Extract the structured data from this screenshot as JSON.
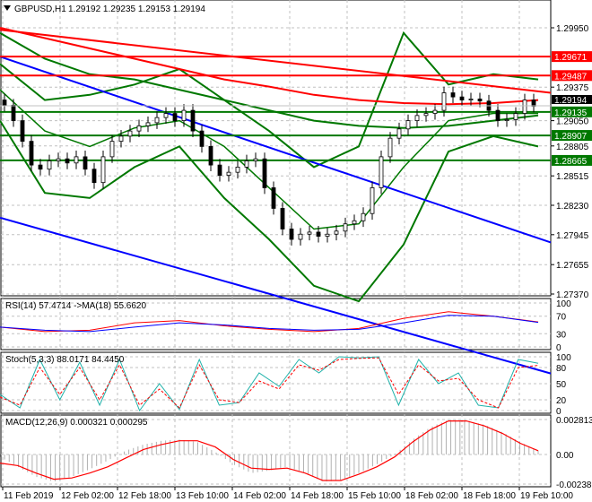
{
  "header": {
    "symbol": "GBPUSD,H1",
    "ohlc": "1.29192 1.29235 1.29153 1.29194"
  },
  "colors": {
    "bull": "#000000",
    "bear": "#000000",
    "band": "#007800",
    "ma": "#ff0000",
    "trend": "#0000ff",
    "grid": "#c0c0c0"
  },
  "price_axis": {
    "ticks": [
      "1.29950",
      "1.29375",
      "1.29050",
      "1.28805",
      "1.28515",
      "1.28230",
      "1.27945",
      "1.27655",
      "1.27370"
    ],
    "tick_values": [
      1.2995,
      1.29375,
      1.2905,
      1.28805,
      1.28515,
      1.2823,
      1.27945,
      1.27655,
      1.2737
    ],
    "min": 1.2737,
    "max": 1.2995
  },
  "levels": [
    {
      "label": "1.29671",
      "value": 1.29671,
      "color": "#ff0000"
    },
    {
      "label": "1.29487",
      "value": 1.29487,
      "color": "#ff0000"
    },
    {
      "label": "1.29135",
      "value": 1.29135,
      "color": "#007800"
    },
    {
      "label": "1.28907",
      "value": 1.28907,
      "color": "#007800"
    },
    {
      "label": "1.28665",
      "value": 1.28665,
      "color": "#007800"
    }
  ],
  "current_price": {
    "label": "1.29194",
    "value": 1.29194
  },
  "time_axis": [
    "11 Feb 2019",
    "12 Feb 02:00",
    "12 Feb 18:00",
    "13 Feb 10:00",
    "14 Feb 02:00",
    "14 Feb 18:00",
    "15 Feb 10:00",
    "18 Feb 02:00",
    "18 Feb 18:00",
    "19 Feb 10:00"
  ],
  "chart_data": {
    "type": "candlestick",
    "closes": [
      1.292,
      1.2905,
      1.2885,
      1.2862,
      1.2858,
      1.2866,
      1.2868,
      1.2864,
      1.287,
      1.2858,
      1.2845,
      1.287,
      1.2885,
      1.289,
      1.2895,
      1.29,
      1.2903,
      1.2908,
      1.2912,
      1.2905,
      1.2915,
      1.2895,
      1.288,
      1.2862,
      1.2852,
      1.2855,
      1.286,
      1.2866,
      1.2868,
      1.284,
      1.282,
      1.28,
      1.279,
      1.2795,
      1.2797,
      1.2793,
      1.2795,
      1.2798,
      1.2805,
      1.2808,
      1.2815,
      1.284,
      1.287,
      1.2888,
      1.2897,
      1.2905,
      1.291,
      1.2912,
      1.2915,
      1.2932,
      1.2928,
      1.2925,
      1.2926,
      1.2924,
      1.2915,
      1.2905,
      1.2906,
      1.2912,
      1.2925,
      1.2919
    ],
    "bollinger_upper": [
      1.296,
      1.2925,
      1.293,
      1.294,
      1.2955,
      1.2925,
      1.2895,
      1.286,
      1.288,
      1.299,
      1.294,
      1.295,
      1.2945
    ],
    "bollinger_lower": [
      1.2905,
      1.2835,
      1.283,
      1.286,
      1.288,
      1.283,
      1.279,
      1.2745,
      1.273,
      1.2785,
      1.2875,
      1.289,
      1.288
    ],
    "bollinger_mid": [
      1.2935,
      1.2895,
      1.288,
      1.2898,
      1.2905,
      1.288,
      1.284,
      1.28,
      1.2805,
      1.286,
      1.2905,
      1.2912,
      1.2912
    ],
    "slow_ma": [
      1.299,
      1.2965,
      1.295,
      1.2945,
      1.2935,
      1.2925,
      1.2915,
      1.2905,
      1.29,
      1.2898,
      1.29,
      1.2905,
      1.291
    ],
    "red_ma": [
      1.2995,
      1.2985,
      1.2975,
      1.2965,
      1.2955,
      1.2945,
      1.2938,
      1.293,
      1.2925,
      1.2922,
      1.2921,
      1.2922,
      1.2925
    ],
    "trendlines": [
      {
        "color": "#0000ff",
        "p1": 1.2967,
        "p2": 1.2787
      },
      {
        "color": "#0000ff",
        "p1": 1.2811,
        "p2": 1.266
      },
      {
        "color": "#ff0000",
        "p1": 1.2993,
        "p2": 1.2932
      }
    ],
    "rsi": {
      "label": "RSI(14) 57.4714  ->MA(18) 55.6620",
      "ticks": [
        "100",
        "70",
        "30",
        "0"
      ],
      "rsi": [
        45,
        35,
        38,
        55,
        60,
        48,
        40,
        35,
        42,
        65,
        80,
        70,
        57
      ],
      "ma": [
        45,
        38,
        35,
        45,
        55,
        50,
        42,
        38,
        40,
        55,
        72,
        70,
        56
      ]
    },
    "stoch": {
      "label": "Stoch(5,3,3) 88.0171 84.4450",
      "ticks": [
        "100",
        "80",
        "50",
        "20",
        "0"
      ],
      "main": [
        30,
        5,
        95,
        20,
        90,
        10,
        95,
        0,
        50,
        2,
        95,
        10,
        15,
        70,
        45,
        95,
        70,
        100,
        98,
        100,
        10,
        95,
        50,
        70,
        10,
        5,
        95,
        88
      ],
      "signal": [
        25,
        10,
        80,
        30,
        80,
        20,
        85,
        10,
        40,
        5,
        85,
        20,
        15,
        55,
        40,
        85,
        75,
        95,
        97,
        98,
        30,
        85,
        55,
        60,
        20,
        5,
        80,
        84
      ]
    },
    "macd": {
      "label": "MACD(12,26,9) 0.000321 0.000295",
      "ticks": [
        "0.002813",
        "0.00",
        "-0.002388"
      ],
      "max": 0.002813,
      "min": -0.002388,
      "hist": [
        -2,
        -10,
        -18,
        -22,
        -18,
        -12,
        -5,
        3,
        8,
        11,
        12,
        10,
        2,
        -8,
        -15,
        -13,
        -10,
        -15,
        -22,
        -21,
        -15,
        -8,
        0,
        12,
        22,
        28,
        27,
        24,
        18,
        10,
        3
      ],
      "signal": [
        -7,
        -9,
        -15,
        -20,
        -19,
        -15,
        -10,
        -3,
        4,
        8,
        11,
        11,
        6,
        -4,
        -11,
        -12,
        -11,
        -15,
        -21,
        -21,
        -16,
        -10,
        -2,
        10,
        20,
        27,
        27,
        23,
        17,
        9,
        3
      ]
    }
  }
}
